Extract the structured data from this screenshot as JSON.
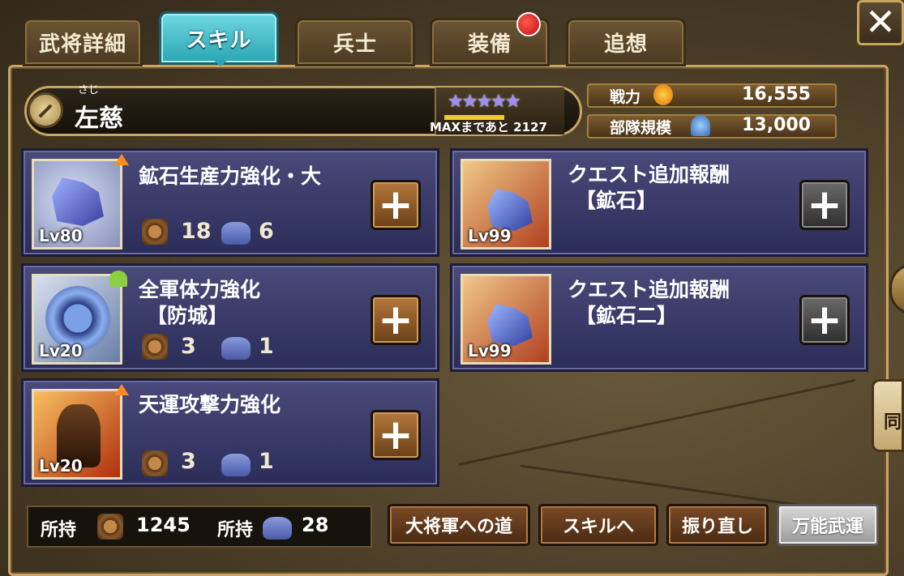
{
  "tabs": [
    {
      "label": "武将詳細",
      "active": false
    },
    {
      "label": "スキル",
      "active": true
    },
    {
      "label": "兵士",
      "active": false
    },
    {
      "label": "装備",
      "active": false,
      "badge": true
    },
    {
      "label": "追想",
      "active": false
    }
  ],
  "close_label": "✕",
  "general": {
    "name_ruby": "さじ",
    "name": "左慈",
    "stars": "★★★★★",
    "rank_progress": "MAXまであと 2127"
  },
  "stats": {
    "power_label": "戦力",
    "power_value": "16,555",
    "troop_label": "部隊規模",
    "troop_value": "13,000"
  },
  "skills": [
    {
      "title_1": "鉱石生産力強化・大",
      "title_2": "",
      "level": "Lv80",
      "cost_coin": "18",
      "cost_ore": "6",
      "button": "+"
    },
    {
      "title_1": "クエスト追加報酬",
      "title_2": "【鉱石】",
      "level": "Lv99",
      "button": "+"
    },
    {
      "title_1": "全軍体力強化",
      "title_2": "【防城】",
      "level": "Lv20",
      "cost_coin": "3",
      "cost_ore": "1",
      "button": "+"
    },
    {
      "title_1": "クエスト追加報酬",
      "title_2": "【鉱石二】",
      "level": "Lv99",
      "button": "+"
    },
    {
      "title_1": "天運攻撃力強化",
      "title_2": "",
      "level": "Lv20",
      "cost_coin": "3",
      "cost_ore": "1",
      "button": "+"
    }
  ],
  "owned": {
    "label": "所持",
    "coin_value": "1245",
    "ore_value": "28"
  },
  "buttons": {
    "general_road": "大将軍への道",
    "to_skill": "スキルへ",
    "reroll": "振り直し",
    "universal": "万能武運"
  },
  "side_tab": "同",
  "colors": {
    "active_tab": "#2aa6b4",
    "card_bg": "#3a3a6a",
    "gold_border": "#c9a660"
  }
}
